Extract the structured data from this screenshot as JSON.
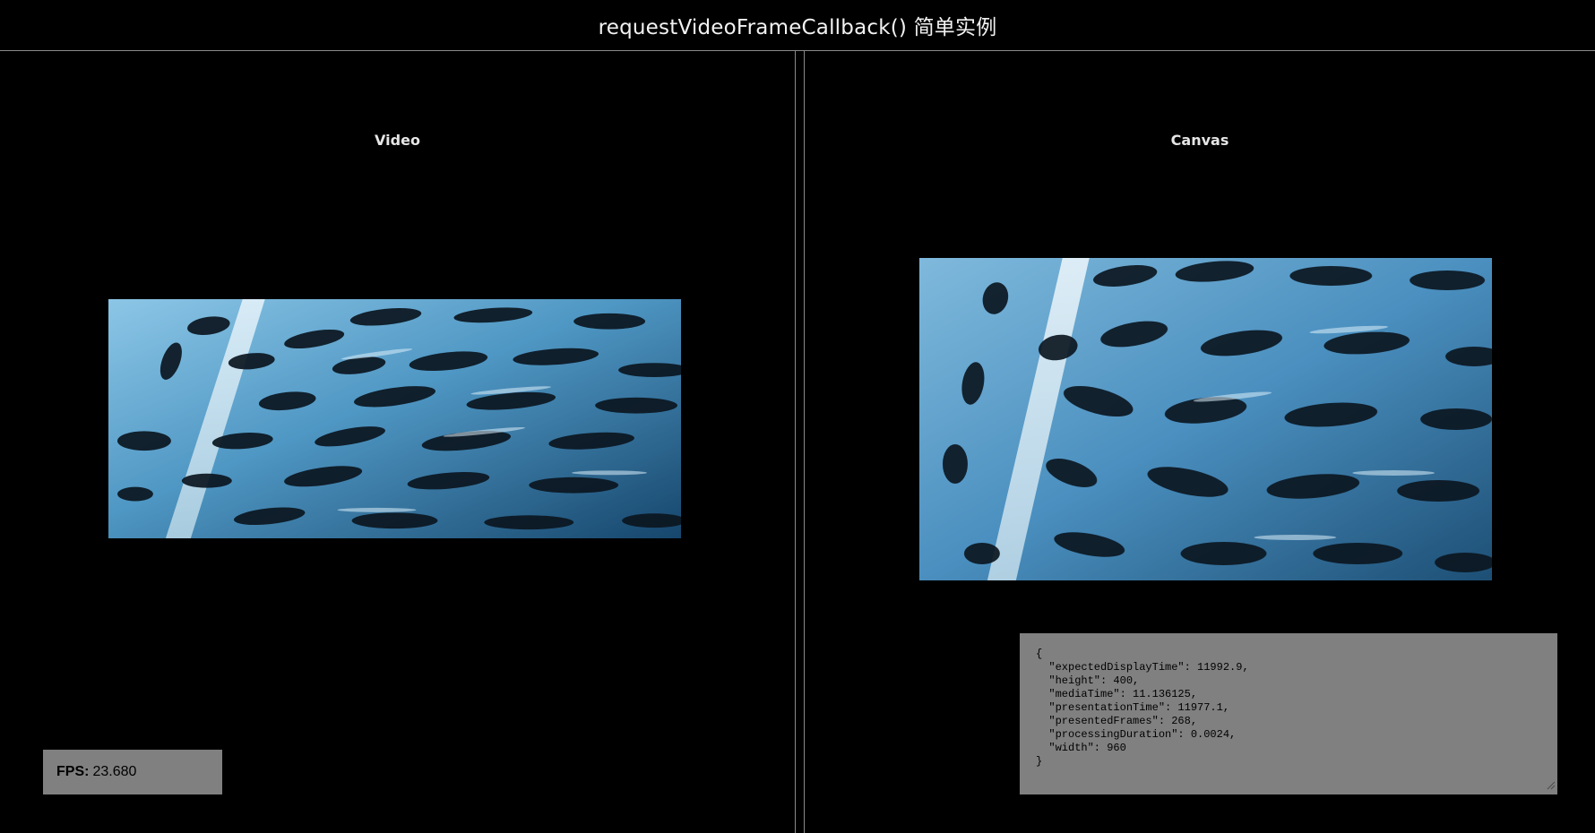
{
  "page": {
    "title": "requestVideoFrameCallback() 简单实例"
  },
  "video_pane": {
    "label": "Video"
  },
  "canvas_pane": {
    "label": "Canvas"
  },
  "fps": {
    "label": "FPS:",
    "value": "23.680"
  },
  "metadata": {
    "text": "{\n  \"expectedDisplayTime\": 11992.9,\n  \"height\": 400,\n  \"mediaTime\": 11.136125,\n  \"presentationTime\": 11977.1,\n  \"presentedFrames\": 268,\n  \"processingDuration\": 0.0024,\n  \"width\": 960\n}"
  },
  "colors": {
    "background": "#000000",
    "panel_gray": "#808080",
    "divider": "#8a8a8a",
    "water_light": "#9fd0ea",
    "water_dark": "#1d5a85"
  },
  "icons": {
    "resize": "resize-grip-icon"
  }
}
